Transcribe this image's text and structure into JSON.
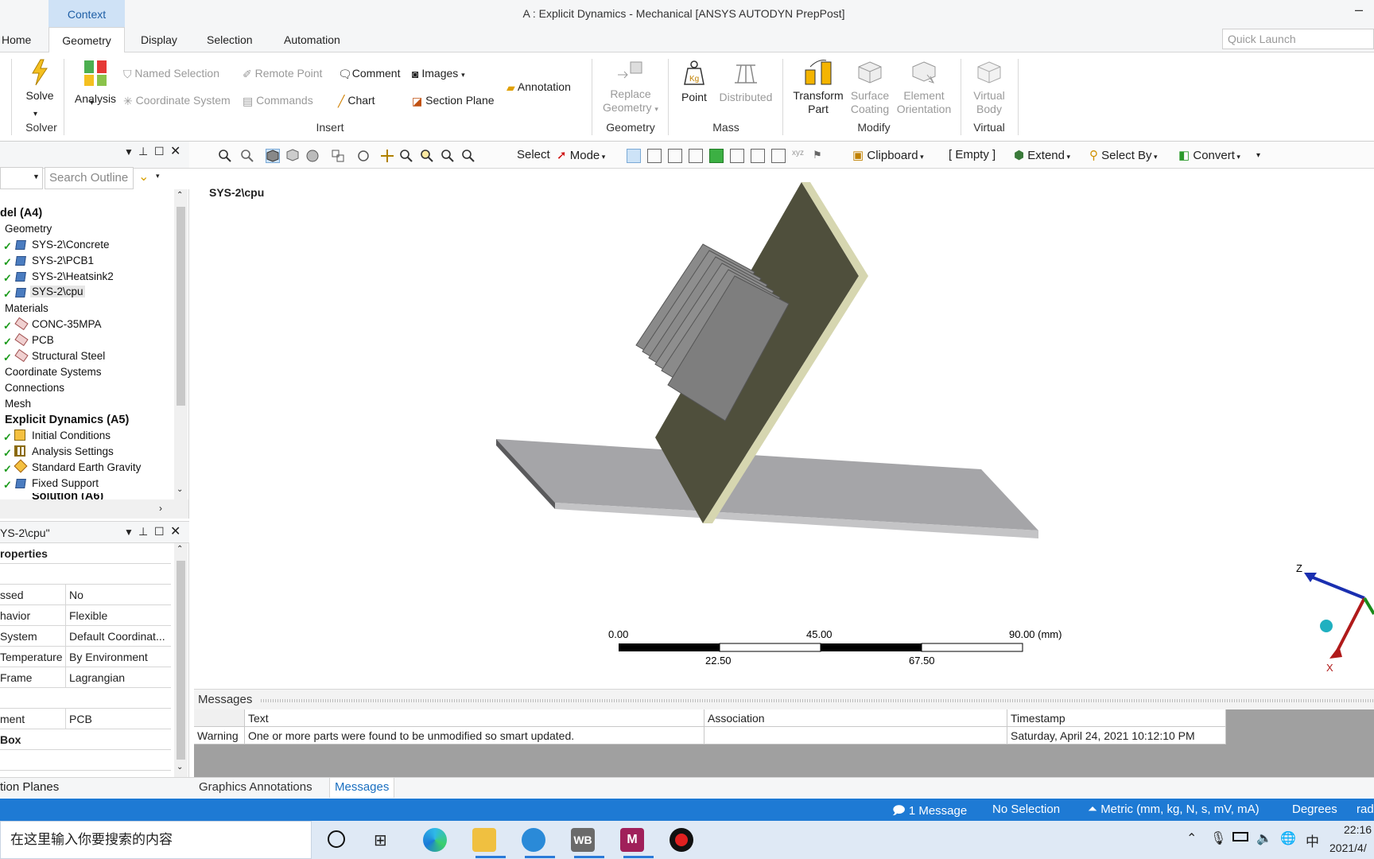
{
  "window": {
    "title": "A : Explicit Dynamics - Mechanical [ANSYS AUTODYN PrepPost]",
    "context_tab": "Context",
    "minimize": "–"
  },
  "menu_tabs": [
    "Home",
    "Geometry",
    "Display",
    "Selection",
    "Automation"
  ],
  "quick_launch": {
    "placeholder": "Quick Launch"
  },
  "ribbon": {
    "solve": "Solve",
    "analysis": "Analysis",
    "solver_group": "Solver",
    "named_selection": "Named Selection",
    "remote_point": "Remote Point",
    "comment": "Comment",
    "images": "Images",
    "coordinate_system": "Coordinate System",
    "commands": "Commands",
    "chart": "Chart",
    "section_plane": "Section Plane",
    "annotation": "Annotation",
    "insert_group": "Insert",
    "replace_geometry_1": "Replace",
    "replace_geometry_2": "Geometry",
    "geometry_group": "Geometry",
    "point": "Point",
    "distributed": "Distributed",
    "mass_group": "Mass",
    "transform_1": "Transform",
    "transform_2": "Part",
    "surface_1": "Surface",
    "surface_2": "Coating",
    "element_1": "Element",
    "element_2": "Orientation",
    "modify_group": "Modify",
    "virtual_1": "Virtual",
    "virtual_2": "Body",
    "virtual_group": "Virtual"
  },
  "toolbar": {
    "select": "Select",
    "mode": "Mode",
    "clipboard": "Clipboard",
    "empty": "[ Empty ]",
    "extend": "Extend",
    "select_by": "Select By",
    "convert": "Convert"
  },
  "outline": {
    "search_placeholder": "Search Outline",
    "items": [
      {
        "label": "del (A4)",
        "bold": true
      },
      {
        "label": "Geometry"
      },
      {
        "label": "SYS-2\\Concrete"
      },
      {
        "label": "SYS-2\\PCB1"
      },
      {
        "label": "SYS-2\\Heatsink2"
      },
      {
        "label": "SYS-2\\cpu"
      },
      {
        "label": "Materials"
      },
      {
        "label": "CONC-35MPA"
      },
      {
        "label": "PCB"
      },
      {
        "label": "Structural Steel"
      },
      {
        "label": "Coordinate Systems"
      },
      {
        "label": "Connections"
      },
      {
        "label": "Mesh"
      },
      {
        "label": "Explicit Dynamics (A5)",
        "bold": true
      },
      {
        "label": "Initial Conditions"
      },
      {
        "label": "Analysis Settings"
      },
      {
        "label": "Standard Earth Gravity"
      },
      {
        "label": "Fixed Support"
      },
      {
        "label": "Solution (A6)",
        "bold": true
      }
    ]
  },
  "details": {
    "title": "YS-2\\cpu\"",
    "section": "roperties",
    "rows": [
      {
        "key": "ssed",
        "value": "No"
      },
      {
        "key": "havior",
        "value": "Flexible"
      },
      {
        "key": " System",
        "value": "Default Coordinat..."
      },
      {
        "key": "Temperature",
        "value": "By Environment"
      },
      {
        "key": "Frame",
        "value": "Lagrangian"
      },
      {
        "key": "",
        "value": ""
      },
      {
        "key": "ment",
        "value": "PCB"
      }
    ],
    "box_section": "Box",
    "bottom_tab": "tion Planes"
  },
  "viewport": {
    "label": "SYS-2\\cpu",
    "scale": {
      "t0": "0.00",
      "t45": "45.00",
      "t90": "90.00 (mm)",
      "t22": "22.50",
      "t67": "67.50"
    },
    "axis_z": "Z",
    "axis_x": "X"
  },
  "messages": {
    "title": "Messages",
    "columns": [
      "Text",
      "Association",
      "Timestamp"
    ],
    "row": {
      "type": "Warning",
      "text": "One or more parts were found to be unmodified so smart updated.",
      "association": "",
      "timestamp": "Saturday, April 24, 2021 10:12:10 PM"
    },
    "tabs": [
      "Graphics Annotations",
      "Messages"
    ]
  },
  "status": {
    "messages": "1 Message",
    "selection": "No Selection",
    "units": "Metric (mm, kg, N, s, mV, mA)",
    "degrees": "Degrees",
    "rad": "rad"
  },
  "taskbar": {
    "search": "在这里输入你要搜索的内容",
    "wb": "WB",
    "m": "M",
    "ime": "中",
    "time": "22:16",
    "date": "2021/4/"
  }
}
